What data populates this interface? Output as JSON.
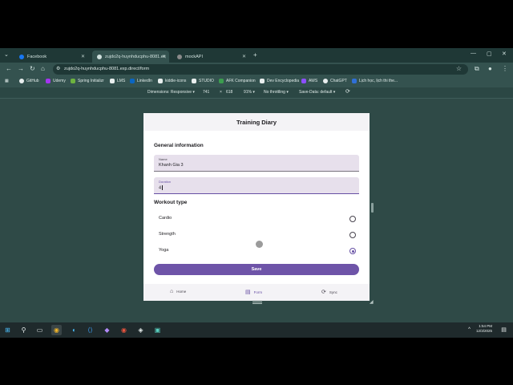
{
  "browser": {
    "tabs": [
      {
        "label": "Facebook",
        "color": "#1877f2"
      },
      {
        "label": "zujdo2q-huynhducphu-8081.exp.direct/form",
        "color": "#6e54a8"
      },
      {
        "label": "mockAPI",
        "color": "#8a8a8a"
      }
    ],
    "new_tab": "+",
    "address": "zujdo2q-huynhducphu-8081.exp.direct/form",
    "bookmarks": [
      {
        "label": "GitHub",
        "color": "#e8eeee"
      },
      {
        "label": "Udemy",
        "color": "#a435f0"
      },
      {
        "label": "Spring Initializr",
        "color": "#6db33f"
      },
      {
        "label": "LMS",
        "color": "#e8eeee"
      },
      {
        "label": "LinkedIn",
        "color": "#0a66c2"
      },
      {
        "label": "kiddie-icons",
        "color": "#e8eeee"
      },
      {
        "label": "STUDIO",
        "color": "#222222"
      },
      {
        "label": "AFK Companion",
        "color": "#3c9d4f"
      },
      {
        "label": "Dev Encyclopedia",
        "color": "#222222"
      },
      {
        "label": "AWS",
        "color": "#8c4fff"
      },
      {
        "label": "ChatGPT",
        "color": "#e8eeee"
      },
      {
        "label": "Lịch học, lịch thi the...",
        "color": "#2f6fd6"
      }
    ]
  },
  "devtools": {
    "dimensions_label": "Dimensions: Responsive",
    "width": "741",
    "times": "×",
    "height": "618",
    "zoom": "91%",
    "throttling": "No throttling",
    "save_data": "Save-Data: default"
  },
  "app": {
    "title": "Training Diary",
    "general_section": "General information",
    "name_label": "Name",
    "name_value": "Khanh Gia 3",
    "duration_label": "Duration",
    "duration_value": "4",
    "workout_section": "Workout type",
    "workout_options": [
      {
        "label": "Cardio",
        "selected": false
      },
      {
        "label": "Strength",
        "selected": false
      },
      {
        "label": "Yoga",
        "selected": true
      }
    ],
    "save_label": "Save",
    "nav": [
      {
        "label": "Home",
        "icon": "home-icon",
        "active": false
      },
      {
        "label": "Form",
        "icon": "form-icon",
        "active": true
      },
      {
        "label": "Sync",
        "icon": "sync-icon",
        "active": false
      }
    ],
    "accent": "#6e54a8"
  },
  "taskbar": {
    "time": "1:54 PM",
    "date": "12/3/2025"
  }
}
